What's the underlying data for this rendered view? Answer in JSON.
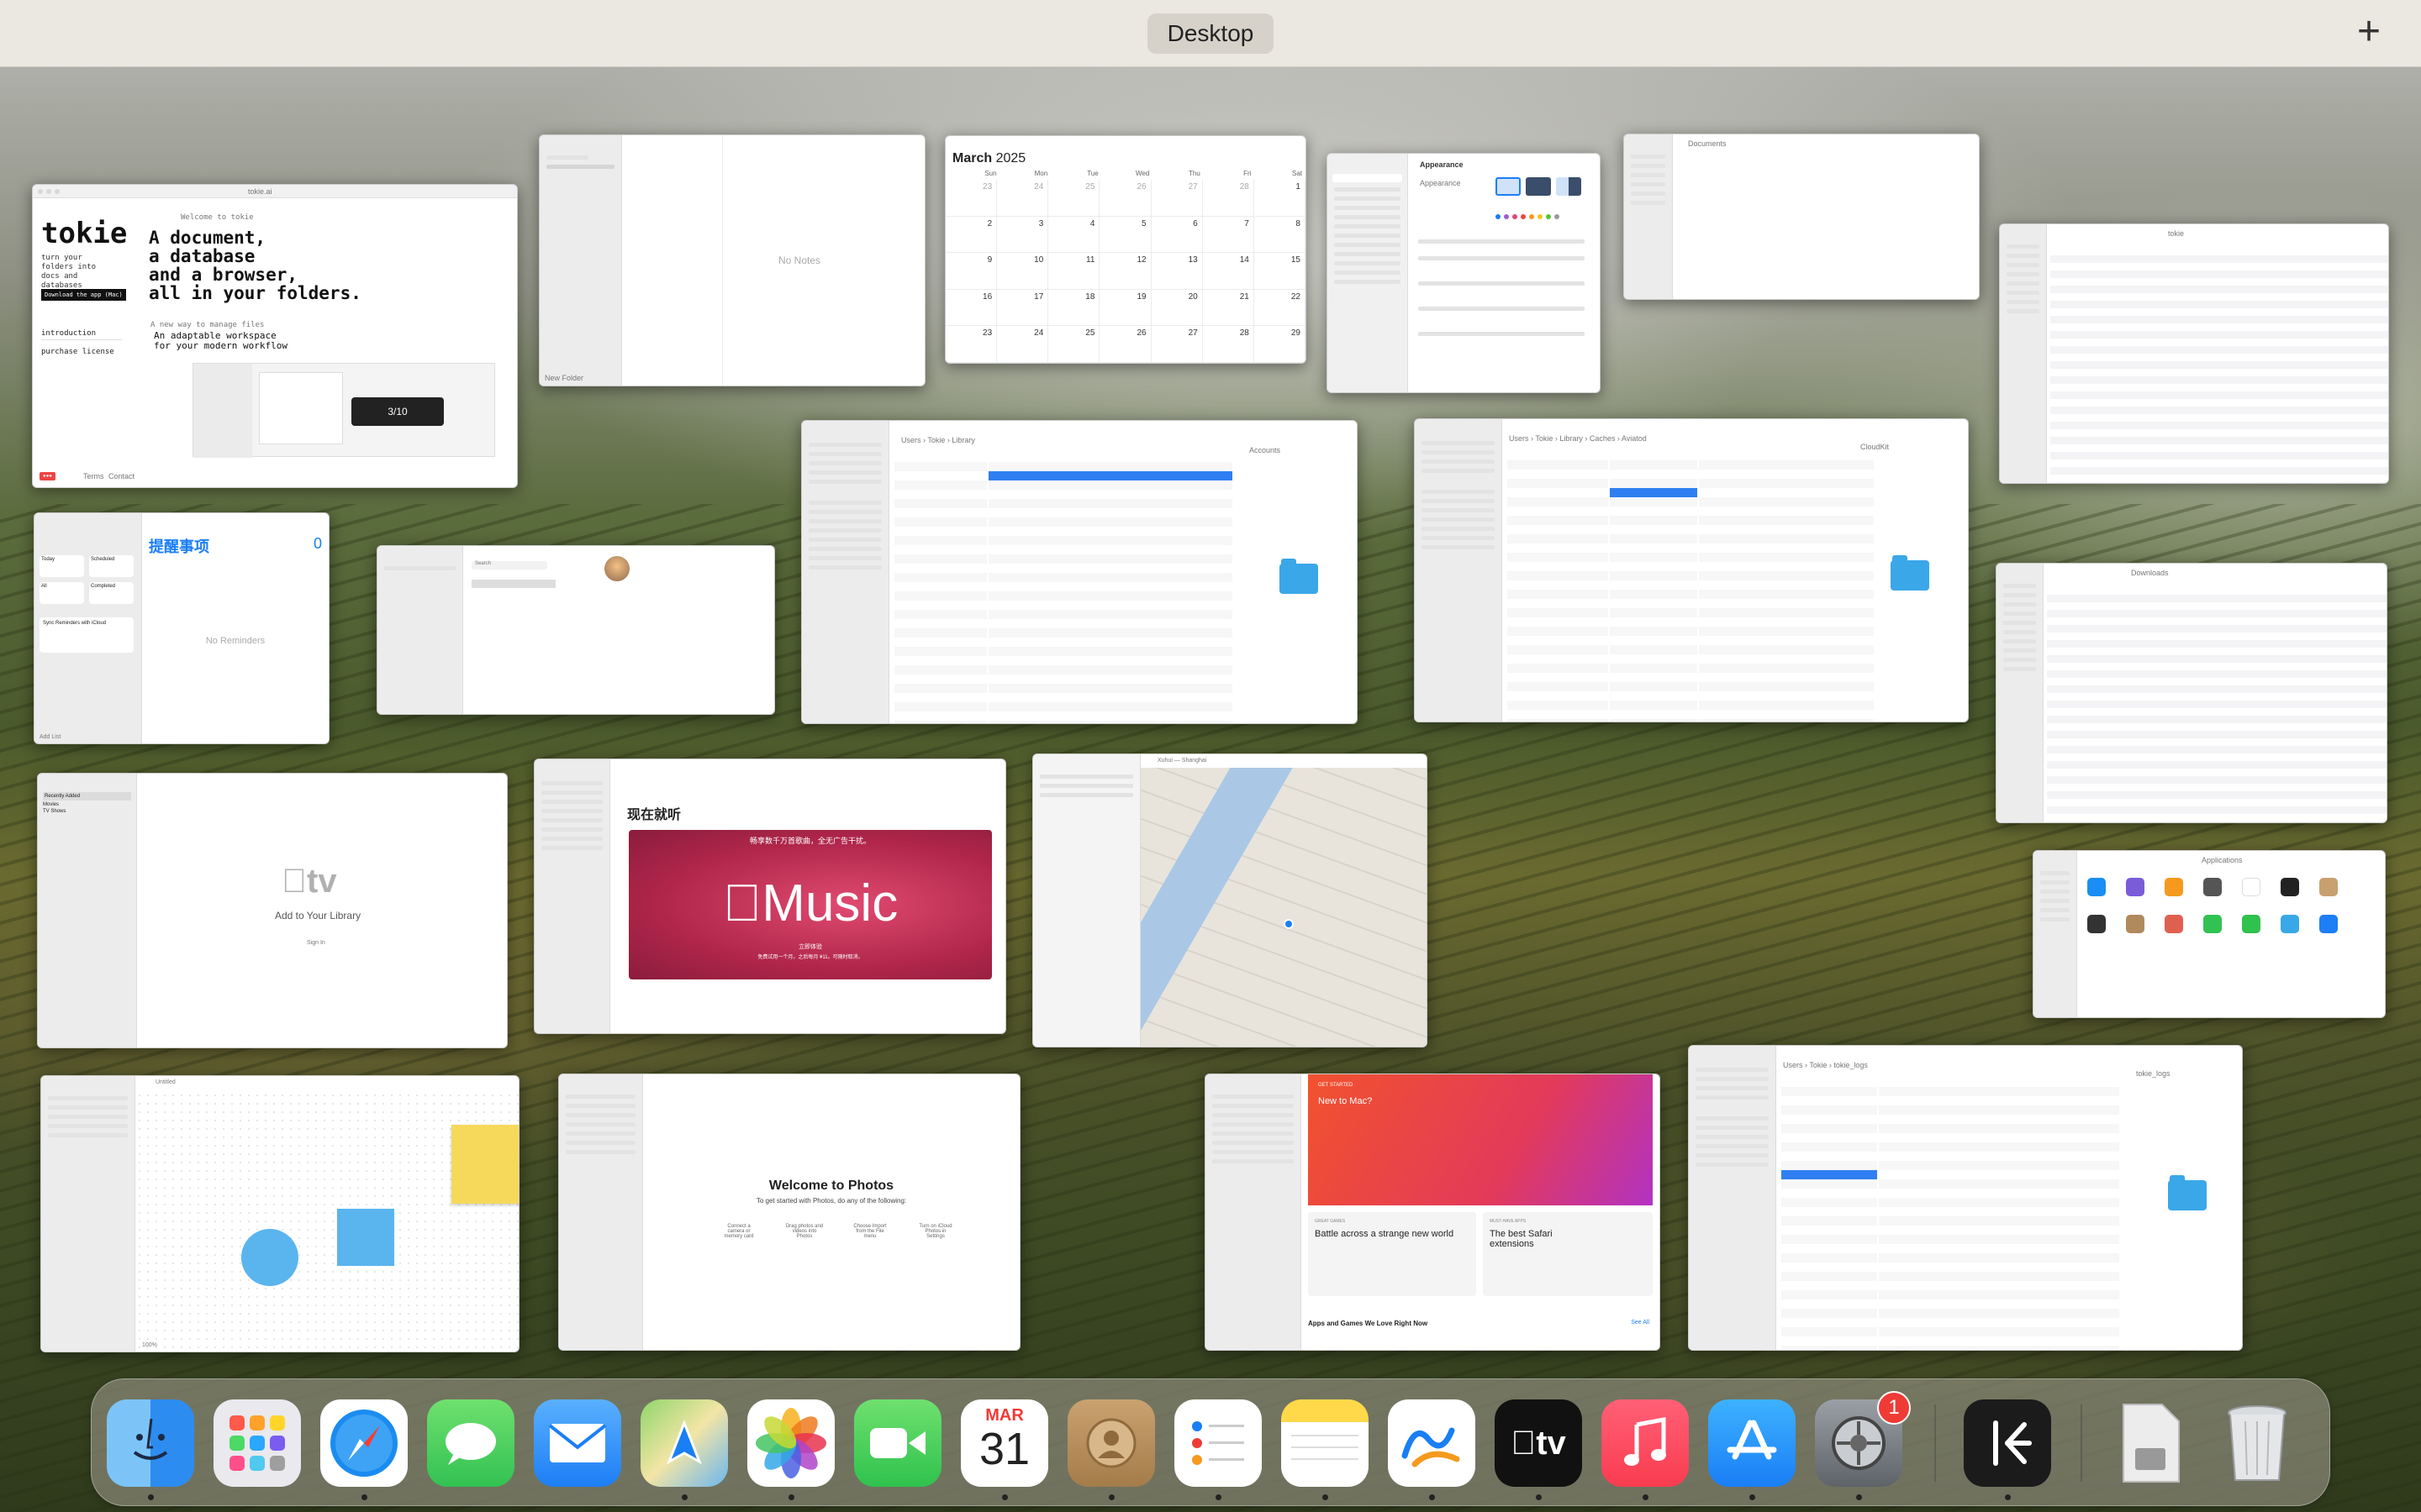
{
  "spaces_bar": {
    "title": "Desktop",
    "add_symbol": "+"
  },
  "tokie": {
    "url": "tokie.ai",
    "logo": "tokie",
    "welcome": "Welcome to tokie",
    "tagline": "turn your folders into docs and databases",
    "download": "Download the app (Mac)",
    "nav": [
      "introduction",
      "purchase license"
    ],
    "headline": [
      "A document,",
      "a database",
      "and a browser,",
      "all in your folders."
    ],
    "sub_small": "A new way to manage files",
    "sub": [
      "An adaptable workspace",
      "for your modern workflow"
    ],
    "footer": [
      "Terms",
      "Contact"
    ]
  },
  "notes": {
    "empty": "No Notes",
    "footer": "New Folder"
  },
  "calendar": {
    "month": "March",
    "year": "2025",
    "days": [
      "Sun",
      "Mon",
      "Tue",
      "Wed",
      "Thu",
      "Fri",
      "Sat"
    ],
    "dates": [
      "23",
      "24",
      "25",
      "26",
      "27",
      "28",
      "1",
      "2",
      "3",
      "4",
      "5",
      "6",
      "7",
      "8",
      "9",
      "10",
      "11",
      "12",
      "13",
      "14",
      "15",
      "16",
      "17",
      "18",
      "19",
      "20",
      "21",
      "22",
      "23",
      "24",
      "25",
      "26",
      "27",
      "28",
      "29"
    ],
    "today": "31"
  },
  "settings": {
    "title": "Appearance",
    "label": "Appearance",
    "options": [
      "Light",
      "Dark",
      "Auto"
    ]
  },
  "documents": {
    "title": "Documents"
  },
  "finder_tokie": {
    "title": "tokie"
  },
  "finder_accounts": {
    "path": "Users › Tokie › Library",
    "preview": "Accounts"
  },
  "finder_cloudkit": {
    "path": "Users › Tokie › Library › Caches › Aviatod",
    "preview": "CloudKit"
  },
  "reminders": {
    "title": "提醒事项",
    "count": "0",
    "empty": "No Reminders",
    "icloud": "Sync Reminders with iCloud",
    "lists": [
      "Today",
      "Scheduled",
      "All",
      "Completed"
    ],
    "footer": "Add List"
  },
  "contacts": {
    "search": "Search"
  },
  "downloads": {
    "title": "Downloads"
  },
  "appletv": {
    "logo": "tv",
    "title": "Add to Your Library",
    "signin": "Sign In",
    "side": [
      "Recently Added",
      "Movies",
      "TV Shows"
    ]
  },
  "music": {
    "heading": "现在就听",
    "banner_top": "畅享数千万首歌曲，全无广告干扰。",
    "banner_logo": "Music",
    "banner_bottom": "立即体验",
    "banner_note": "免费试用一个月，之后每月 ¥11。可随时取消。"
  },
  "maps": {
    "title": "Xuhui — Shanghai"
  },
  "applications": {
    "title": "Applications"
  },
  "freeform": {
    "title": "Untitled",
    "zoom": "100%"
  },
  "photos": {
    "title": "Welcome to Photos",
    "sub": "To get started with Photos, do any of the following:",
    "options": [
      "Connect a camera or memory card",
      "Drag photos and videos into Photos",
      "Choose Import from the File menu",
      "Turn on iCloud Photos in Settings"
    ]
  },
  "appstore": {
    "new": "New to Mac?",
    "card1": "Battle across a strange new world",
    "card2": "The best Safari extensions",
    "section": "Apps and Games We Love Right Now",
    "see_all": "See All",
    "label1": "GET STARTED",
    "label2": "GREAT GAMES",
    "label3": "MUST-HAVE APPS"
  },
  "finder_logs": {
    "path": "Users › Tokie › tokie_logs",
    "preview": "tokie_logs"
  },
  "dock": {
    "calendar_month": "MAR",
    "calendar_day": "31",
    "settings_badge": "1",
    "apps": [
      "finder-icon",
      "launchpad-icon",
      "safari-icon",
      "messages-icon",
      "mail-icon",
      "maps-icon",
      "photos-icon",
      "facetime-icon",
      "calendar-icon",
      "contacts-icon",
      "reminders-icon",
      "notes-icon",
      "freeform-icon",
      "tv-icon",
      "music-icon",
      "app-store-icon",
      "system-settings-icon",
      "tokie-icon",
      "downloads-stack-icon",
      "trash-icon"
    ],
    "colors": {
      "finder": "#2d8cf0",
      "safari": "#1a8cf0",
      "messages": "#32c252",
      "mail": "#1d7ef5",
      "facetime": "#2fc24d",
      "music": "#fa3c50",
      "appstore": "#1a8ef4",
      "tv": "#111111"
    }
  }
}
